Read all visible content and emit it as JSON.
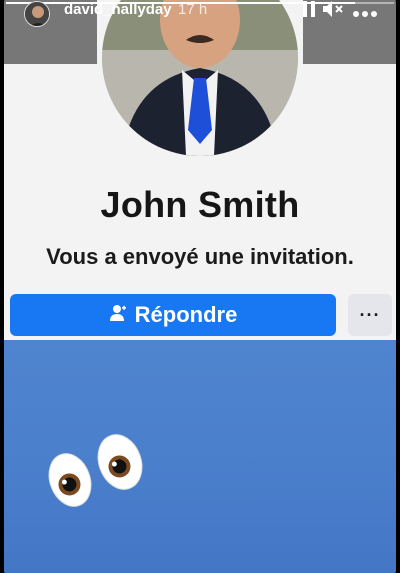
{
  "story": {
    "username": "david_hallyday",
    "time": "17 h",
    "progress": 0.9
  },
  "invitation": {
    "name": "John Smith",
    "message": "Vous a envoyé une invitation.",
    "reply_label": "Répondre",
    "more_label": "···"
  },
  "icons": {
    "pause": "pause-icon",
    "mute": "mute-icon",
    "more": "more-icon",
    "reply": "person-icon",
    "sticker": "eyes-emoji"
  },
  "colors": {
    "reply_button": "#1877f2",
    "background_blue": "#4a7fcc"
  }
}
